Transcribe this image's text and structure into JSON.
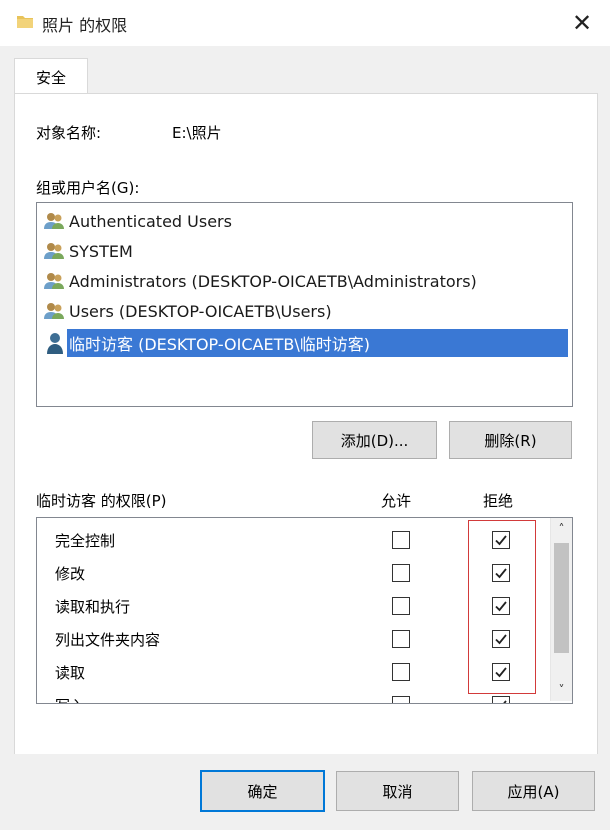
{
  "window": {
    "title": "照片 的权限",
    "title_icon": "folder-icon"
  },
  "tab": {
    "label": "安全"
  },
  "object": {
    "label": "对象名称:",
    "value": "E:\\照片"
  },
  "group_section": {
    "label": "组或用户名(G):"
  },
  "users": [
    {
      "name": "Authenticated Users",
      "icon": "users-group-icon"
    },
    {
      "name": "SYSTEM",
      "icon": "users-group-icon"
    },
    {
      "name": "Administrators (DESKTOP-OICAETB\\Administrators)",
      "icon": "users-group-icon"
    },
    {
      "name": "Users (DESKTOP-OICAETB\\Users)",
      "icon": "users-group-icon"
    },
    {
      "name": "临时访客 (DESKTOP-OICAETB\\临时访客)",
      "icon": "user-icon",
      "selected": true
    }
  ],
  "buttons": {
    "add": "添加(D)...",
    "remove": "删除(R)",
    "ok": "确定",
    "cancel": "取消",
    "apply": "应用(A)"
  },
  "permissions": {
    "label": "临时访客 的权限(P)",
    "allow_header": "允许",
    "deny_header": "拒绝",
    "rows": [
      {
        "name": "完全控制",
        "allow": false,
        "deny": true
      },
      {
        "name": "修改",
        "allow": false,
        "deny": true
      },
      {
        "name": "读取和执行",
        "allow": false,
        "deny": true
      },
      {
        "name": "列出文件夹内容",
        "allow": false,
        "deny": true
      },
      {
        "name": "读取",
        "allow": false,
        "deny": true
      },
      {
        "name": "写入",
        "allow": false,
        "deny": true
      }
    ]
  },
  "colors": {
    "selection": "#3a78d4",
    "highlight_box": "#d23a3a",
    "default_button_border": "#0078d7"
  }
}
